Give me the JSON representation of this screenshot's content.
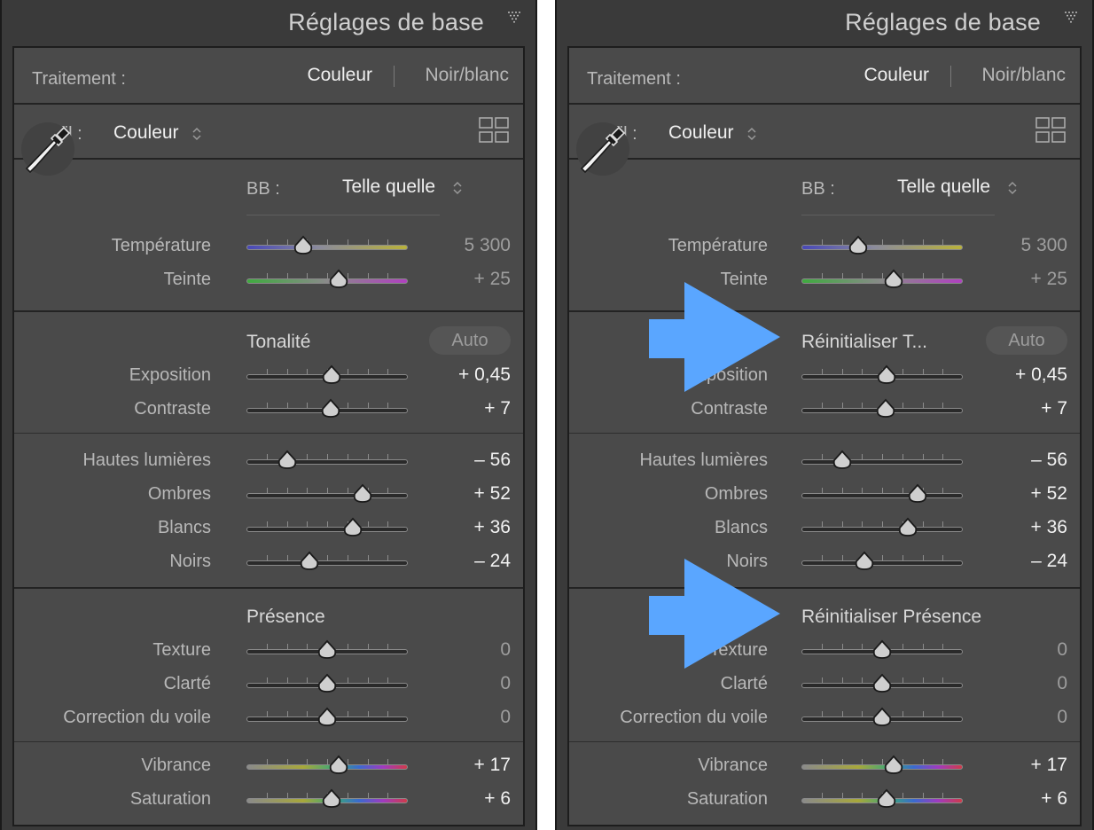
{
  "header_title": "Réglages de base",
  "traitement": {
    "label": "Traitement :",
    "couleur": "Couleur",
    "noirblanc": "Noir/blanc"
  },
  "profil": {
    "label": "Profil :",
    "value": "Couleur"
  },
  "bb": {
    "label": "BB :",
    "value": "Telle quelle"
  },
  "tonalite": {
    "title_left": "Tonalité",
    "title_right": "Réinitialiser T...",
    "auto": "Auto"
  },
  "presence": {
    "title_left": "Présence",
    "title_right": "Réinitialiser Présence"
  },
  "sliders": [
    {
      "label": "Température",
      "value": "5 300",
      "pos": 0.35,
      "gradient": "temp",
      "value_color": "dim"
    },
    {
      "label": "Teinte",
      "value": "+ 25",
      "pos": 0.57,
      "gradient": "tint",
      "value_color": "dim"
    },
    {
      "label": "Exposition",
      "value": "+ 0,45",
      "pos": 0.53,
      "gradient": "none",
      "value_color": "bright"
    },
    {
      "label": "Contraste",
      "value": "+ 7",
      "pos": 0.52,
      "gradient": "none",
      "value_color": "bright"
    },
    {
      "label": "Hautes lumières",
      "value": "– 56",
      "pos": 0.25,
      "gradient": "none",
      "value_color": "bright"
    },
    {
      "label": "Ombres",
      "value": "+ 52",
      "pos": 0.72,
      "gradient": "none",
      "value_color": "bright"
    },
    {
      "label": "Blancs",
      "value": "+ 36",
      "pos": 0.66,
      "gradient": "none",
      "value_color": "bright"
    },
    {
      "label": "Noirs",
      "value": "– 24",
      "pos": 0.39,
      "gradient": "none",
      "value_color": "bright"
    },
    {
      "label": "Texture",
      "value": "0",
      "pos": 0.5,
      "gradient": "none",
      "value_color": "dim"
    },
    {
      "label": "Clarté",
      "value": "0",
      "pos": 0.5,
      "gradient": "none",
      "value_color": "dim"
    },
    {
      "label": "Correction du voile",
      "value": "0",
      "pos": 0.5,
      "gradient": "none",
      "value_color": "dim"
    },
    {
      "label": "Vibrance",
      "value": "+ 17",
      "pos": 0.57,
      "gradient": "color",
      "value_color": "bright"
    },
    {
      "label": "Saturation",
      "value": "+ 6",
      "pos": 0.53,
      "gradient": "color",
      "value_color": "bright"
    }
  ],
  "colors": {
    "arrow": "#5aa6ff",
    "panel_bg": "#4a4a4a",
    "header_bg": "#3a3a3a"
  }
}
